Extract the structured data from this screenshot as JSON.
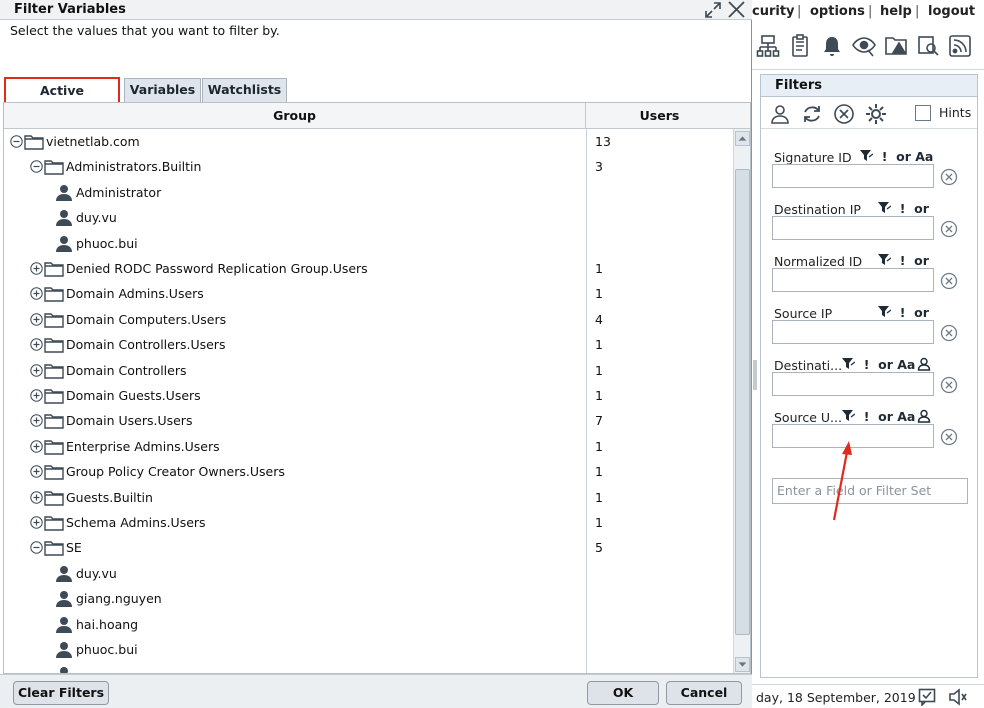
{
  "topnav": {
    "security": "curity",
    "options": "options",
    "help": "help",
    "logout": "logout",
    "sep": "|"
  },
  "filters": {
    "title": "Filters",
    "hints_label": "Hints",
    "rows": [
      {
        "label": "Signature ID",
        "ops": "or Aa"
      },
      {
        "label": "Destination IP",
        "ops": "or"
      },
      {
        "label": "Normalized ID",
        "ops": "or"
      },
      {
        "label": "Source IP",
        "ops": "or"
      },
      {
        "label": "Destinati...",
        "ops": "or Aa"
      },
      {
        "label": "Source U...",
        "ops": "or Aa"
      }
    ],
    "add_placeholder": "Enter a Field or Filter Set"
  },
  "status": {
    "date": "day, 18 September, 2019"
  },
  "dialog": {
    "title": "Filter Variables",
    "instructions": "Select the values that you want to filter by.",
    "tabs": [
      "Active Directory",
      "Variables",
      "Watchlists"
    ],
    "columns": {
      "group": "Group",
      "users": "Users"
    },
    "rows": [
      {
        "level": 0,
        "kind": "folder",
        "expander": "minus",
        "name": "vietnetlab.com",
        "users": "13"
      },
      {
        "level": 1,
        "kind": "folder",
        "expander": "minus",
        "name": "Administrators.Builtin",
        "users": "3"
      },
      {
        "level": 2,
        "kind": "user",
        "name": "Administrator",
        "users": ""
      },
      {
        "level": 2,
        "kind": "user",
        "name": "duy.vu",
        "users": ""
      },
      {
        "level": 2,
        "kind": "user",
        "name": "phuoc.bui",
        "users": ""
      },
      {
        "level": 1,
        "kind": "folder",
        "expander": "plus",
        "name": "Denied RODC Password Replication Group.Users",
        "users": "1"
      },
      {
        "level": 1,
        "kind": "folder",
        "expander": "plus",
        "name": "Domain Admins.Users",
        "users": "1"
      },
      {
        "level": 1,
        "kind": "folder",
        "expander": "plus",
        "name": "Domain Computers.Users",
        "users": "4"
      },
      {
        "level": 1,
        "kind": "folder",
        "expander": "plus",
        "name": "Domain Controllers.Users",
        "users": "1"
      },
      {
        "level": 1,
        "kind": "folder",
        "expander": "plus",
        "name": "Domain Controllers",
        "users": "1"
      },
      {
        "level": 1,
        "kind": "folder",
        "expander": "plus",
        "name": "Domain Guests.Users",
        "users": "1"
      },
      {
        "level": 1,
        "kind": "folder",
        "expander": "plus",
        "name": "Domain Users.Users",
        "users": "7"
      },
      {
        "level": 1,
        "kind": "folder",
        "expander": "plus",
        "name": "Enterprise Admins.Users",
        "users": "1"
      },
      {
        "level": 1,
        "kind": "folder",
        "expander": "plus",
        "name": "Group Policy Creator Owners.Users",
        "users": "1"
      },
      {
        "level": 1,
        "kind": "folder",
        "expander": "plus",
        "name": "Guests.Builtin",
        "users": "1"
      },
      {
        "level": 1,
        "kind": "folder",
        "expander": "plus",
        "name": "Schema Admins.Users",
        "users": "1"
      },
      {
        "level": 1,
        "kind": "folder",
        "expander": "minus",
        "name": "SE",
        "users": "5"
      },
      {
        "level": 2,
        "kind": "user",
        "name": "duy.vu",
        "users": ""
      },
      {
        "level": 2,
        "kind": "user",
        "name": "giang.nguyen",
        "users": ""
      },
      {
        "level": 2,
        "kind": "user",
        "name": "hai.hoang",
        "users": ""
      },
      {
        "level": 2,
        "kind": "user",
        "name": "phuoc.bui",
        "users": ""
      },
      {
        "level": 2,
        "kind": "user",
        "name": "",
        "users": ""
      }
    ],
    "buttons": {
      "clear": "Clear Filters",
      "ok": "OK",
      "cancel": "Cancel"
    }
  },
  "colors": {
    "accent_red": "#e3291b",
    "icon_dark": "#3e4a56"
  }
}
